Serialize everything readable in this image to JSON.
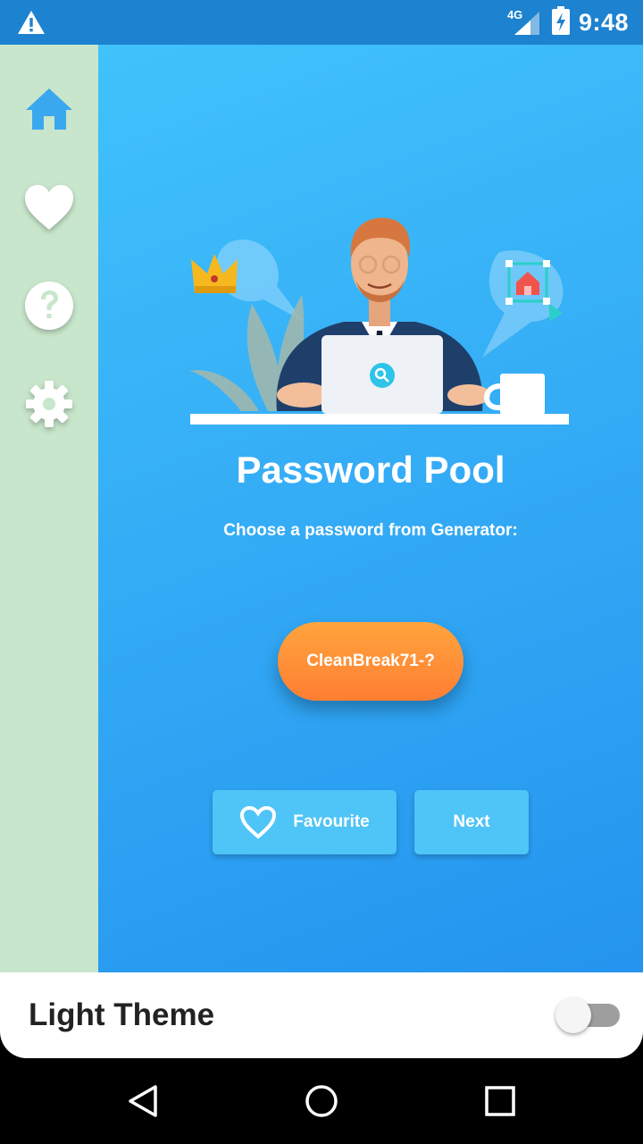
{
  "status_bar": {
    "network": "4G",
    "time": "9:48",
    "icons": [
      "warning-icon",
      "signal-icon",
      "battery-charging-icon"
    ]
  },
  "sidebar": {
    "items": [
      {
        "name": "home",
        "icon": "home-icon",
        "active": true
      },
      {
        "name": "favourites",
        "icon": "heart-icon",
        "active": false
      },
      {
        "name": "help",
        "icon": "help-icon",
        "active": false
      },
      {
        "name": "settings",
        "icon": "gear-icon",
        "active": false
      }
    ]
  },
  "main": {
    "title": "Password Pool",
    "subtitle": "Choose a password from Generator:",
    "password": "CleanBreak71-?",
    "favourite_label": "Favourite",
    "next_label": "Next"
  },
  "theme": {
    "label": "Light Theme",
    "enabled": false
  },
  "colors": {
    "accent_orange": "#ff8a36",
    "content_blue": "#35adf6",
    "sidebar_green": "#c8e6cb",
    "active_icon": "#3aa8ef"
  }
}
